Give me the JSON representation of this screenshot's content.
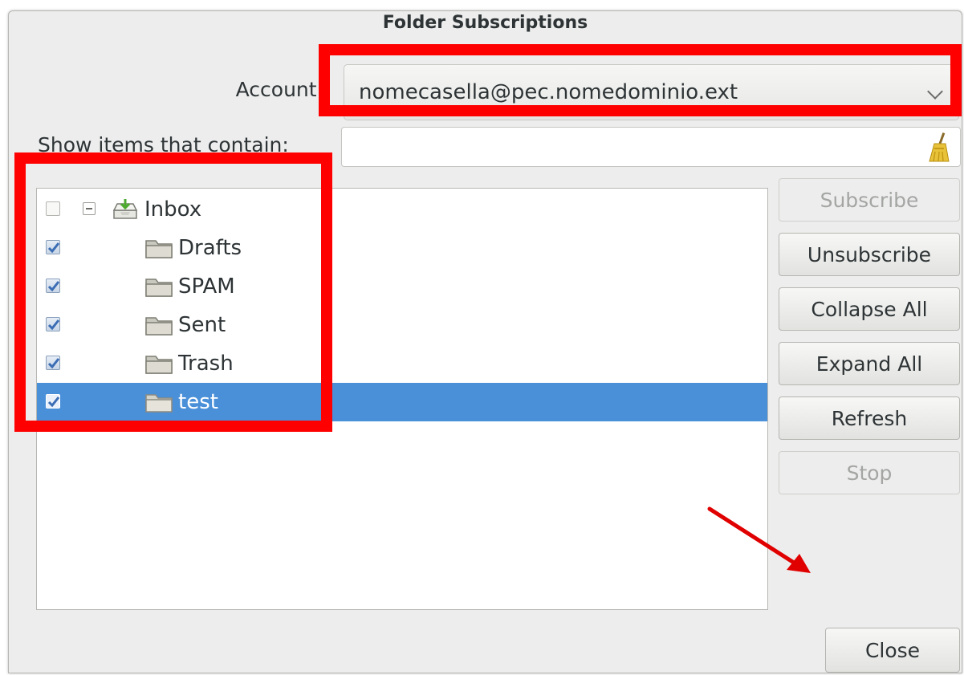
{
  "dialog": {
    "title": "Folder Subscriptions"
  },
  "account": {
    "label": "Account:",
    "value": "nomecasella@pec.nomedominio.ext"
  },
  "filter": {
    "label": "Show items that contain:",
    "value": ""
  },
  "folders": [
    {
      "name": "Inbox",
      "checked": false,
      "icon": "inbox-icon",
      "expanded": true
    },
    {
      "name": "Drafts",
      "checked": true,
      "icon": "folder-icon"
    },
    {
      "name": "SPAM",
      "checked": true,
      "icon": "folder-icon"
    },
    {
      "name": "Sent",
      "checked": true,
      "icon": "folder-icon"
    },
    {
      "name": "Trash",
      "checked": true,
      "icon": "folder-icon"
    },
    {
      "name": "test",
      "checked": true,
      "icon": "folder-icon",
      "selected": true
    }
  ],
  "buttons": {
    "subscribe": "Subscribe",
    "unsubscribe": "Unsubscribe",
    "collapse_all": "Collapse All",
    "expand_all": "Expand All",
    "refresh": "Refresh",
    "stop": "Stop",
    "close": "Close"
  },
  "colors": {
    "annotation": "#ff0000",
    "selection": "#4a90d9"
  }
}
